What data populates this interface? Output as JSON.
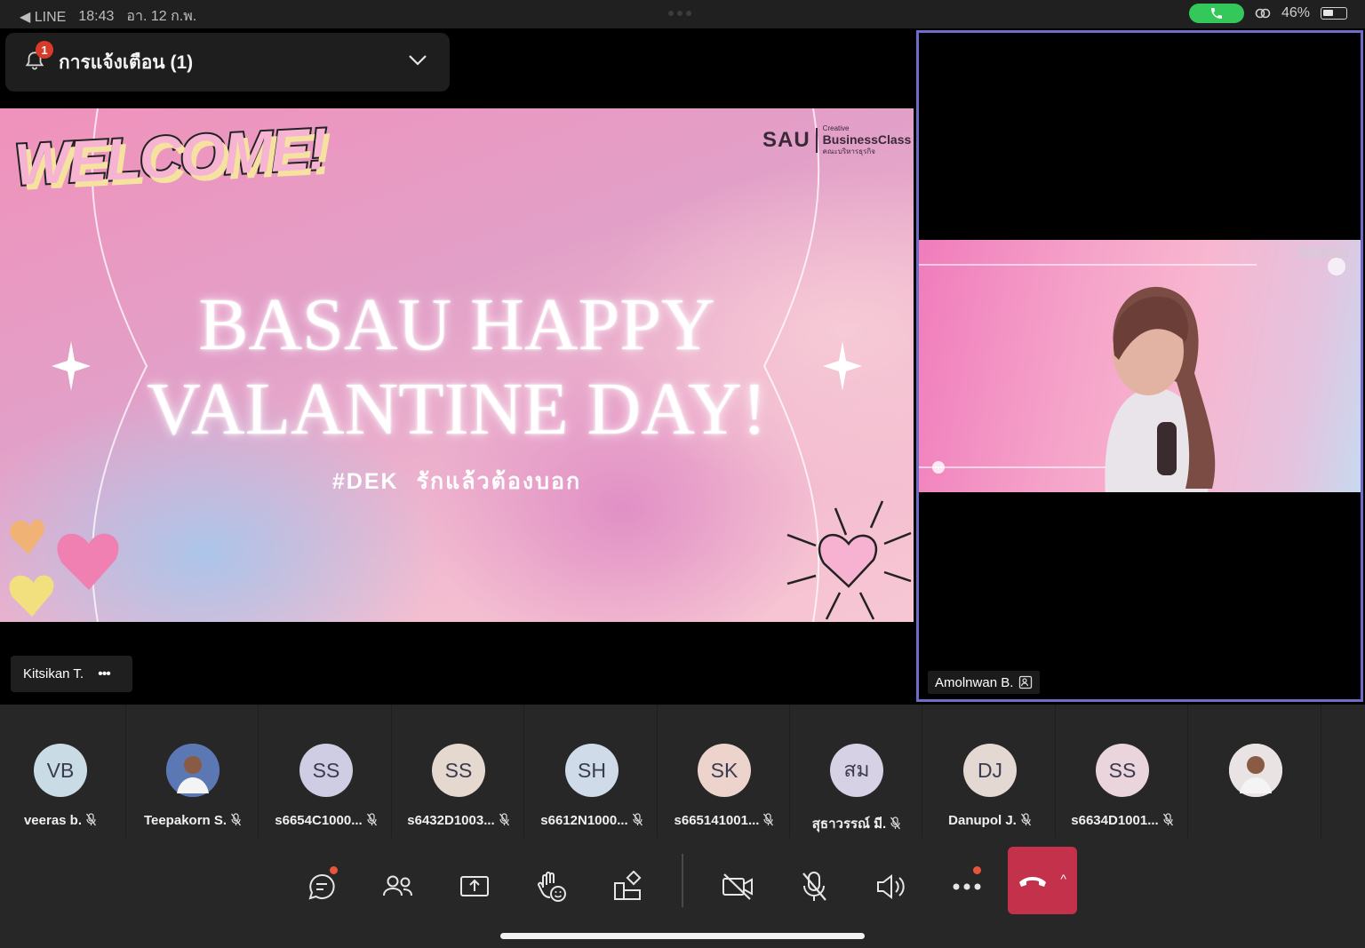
{
  "status_bar": {
    "back_label": "◀ LINE",
    "time": "18:43",
    "date": "อา. 12 ก.พ.",
    "battery": "46%",
    "battery_level": 0.46
  },
  "notification": {
    "label": "การแจ้งเตือน (1)",
    "count": "1"
  },
  "slide": {
    "welcome": "WELCOME!",
    "logo_main": "SAU",
    "logo_line1": "Creative",
    "logo_line2": "BusinessClass",
    "logo_line3": "คณะบริหารธุรกิจ",
    "headline_line1": "BASAU HAPPY",
    "headline_line2": "VALANTINE DAY!",
    "hashtag": "#DEK",
    "tagline": "รักแล้วต้องบอก"
  },
  "presenter": {
    "name": "Kitsikan T.",
    "more": "•••"
  },
  "pinned": {
    "name": "Amolnwan B."
  },
  "participants": [
    {
      "initials": "VB",
      "name": "veeras b.",
      "color": "#c9dce5"
    },
    {
      "initials": "",
      "name": "Teepakorn S.",
      "color": "#5b78b5",
      "photo": true
    },
    {
      "initials": "SS",
      "name": "s6654C1000...",
      "color": "#cfcde4"
    },
    {
      "initials": "SS",
      "name": "s6432D1003...",
      "color": "#e4d8cf"
    },
    {
      "initials": "SH",
      "name": "s6612N1000...",
      "color": "#cfdbe8"
    },
    {
      "initials": "SK",
      "name": "s665141001...",
      "color": "#ecd3cc"
    },
    {
      "initials": "สม",
      "name": "สุธาวรรณ์ มี.",
      "color": "#d7d1e6"
    },
    {
      "initials": "DJ",
      "name": "Danupol J.",
      "color": "#e3d8d2"
    },
    {
      "initials": "SS",
      "name": "s6634D1001...",
      "color": "#ead5dc"
    },
    {
      "initials": "",
      "name": "",
      "color": "#e9e3e3",
      "photo": true
    }
  ],
  "controls": [
    {
      "icon": "chat-icon"
    },
    {
      "icon": "people-icon"
    },
    {
      "icon": "share-screen-icon"
    },
    {
      "icon": "raise-hand-icon"
    },
    {
      "icon": "apps-icon"
    },
    {
      "icon": "camera-off-icon"
    },
    {
      "icon": "mic-off-icon"
    },
    {
      "icon": "speaker-icon"
    },
    {
      "icon": "more-icon"
    },
    {
      "icon": "hang-up-icon"
    }
  ],
  "colors": {
    "accent": "#6e6cc8",
    "hangup": "#c4314b",
    "badge": "#d93b2b"
  }
}
